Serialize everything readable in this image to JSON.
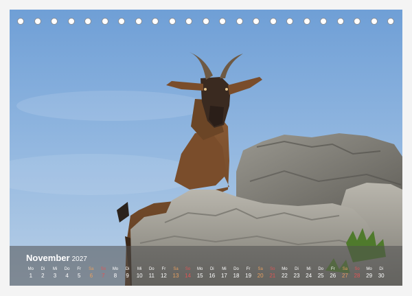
{
  "calendar": {
    "month": "November",
    "year": "2027",
    "days": [
      {
        "wd": "Mo",
        "d": "1",
        "type": "weekday"
      },
      {
        "wd": "Di",
        "d": "2",
        "type": "weekday"
      },
      {
        "wd": "Mi",
        "d": "3",
        "type": "weekday"
      },
      {
        "wd": "Do",
        "d": "4",
        "type": "weekday"
      },
      {
        "wd": "Fr",
        "d": "5",
        "type": "weekday"
      },
      {
        "wd": "Sa",
        "d": "6",
        "type": "sat"
      },
      {
        "wd": "So",
        "d": "7",
        "type": "sun"
      },
      {
        "wd": "Mo",
        "d": "8",
        "type": "weekday"
      },
      {
        "wd": "Di",
        "d": "9",
        "type": "weekday"
      },
      {
        "wd": "Mi",
        "d": "10",
        "type": "weekday"
      },
      {
        "wd": "Do",
        "d": "11",
        "type": "weekday"
      },
      {
        "wd": "Fr",
        "d": "12",
        "type": "weekday"
      },
      {
        "wd": "Sa",
        "d": "13",
        "type": "sat"
      },
      {
        "wd": "So",
        "d": "14",
        "type": "sun"
      },
      {
        "wd": "Mo",
        "d": "15",
        "type": "weekday"
      },
      {
        "wd": "Di",
        "d": "16",
        "type": "weekday"
      },
      {
        "wd": "Mi",
        "d": "17",
        "type": "weekday"
      },
      {
        "wd": "Do",
        "d": "18",
        "type": "weekday"
      },
      {
        "wd": "Fr",
        "d": "19",
        "type": "weekday"
      },
      {
        "wd": "Sa",
        "d": "20",
        "type": "sat"
      },
      {
        "wd": "So",
        "d": "21",
        "type": "sun"
      },
      {
        "wd": "Mo",
        "d": "22",
        "type": "weekday"
      },
      {
        "wd": "Di",
        "d": "23",
        "type": "weekday"
      },
      {
        "wd": "Mi",
        "d": "24",
        "type": "weekday"
      },
      {
        "wd": "Do",
        "d": "25",
        "type": "weekday"
      },
      {
        "wd": "Fr",
        "d": "26",
        "type": "weekday"
      },
      {
        "wd": "Sa",
        "d": "27",
        "type": "sat"
      },
      {
        "wd": "So",
        "d": "28",
        "type": "sun"
      },
      {
        "wd": "Mo",
        "d": "29",
        "type": "weekday"
      },
      {
        "wd": "Di",
        "d": "30",
        "type": "weekday"
      }
    ]
  },
  "colors": {
    "sky": "#8fb5df",
    "strip": "#505050",
    "sunday": "#e05555",
    "saturday": "#e8a060",
    "goat": "#6e4a2e"
  },
  "icons": {
    "binding": "spiral-binding-hole"
  }
}
